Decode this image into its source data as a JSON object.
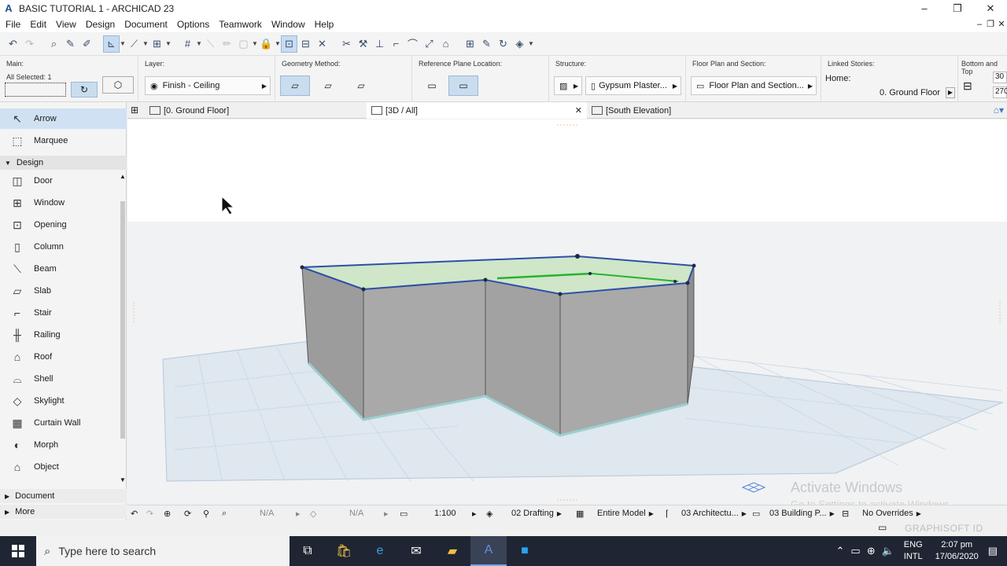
{
  "window": {
    "title": "BASIC TUTORIAL 1 - ARCHICAD 23",
    "controls": [
      "–",
      "❐",
      "✕"
    ]
  },
  "menu": [
    "File",
    "Edit",
    "View",
    "Design",
    "Document",
    "Options",
    "Teamwork",
    "Window",
    "Help"
  ],
  "infobox": {
    "main_label": "Main:",
    "all_selected": "All Selected: 1",
    "layer_label": "Layer:",
    "layer_value": "Finish - Ceiling",
    "geometry_label": "Geometry Method:",
    "refplane_label": "Reference Plane Location:",
    "structure_label": "Structure:",
    "structure_value": "Gypsum Plaster...",
    "floorplan_label": "Floor Plan and Section:",
    "floorplan_value": "Floor Plan and Section...",
    "linked_label": "Linked Stories:",
    "home_label": "Home:",
    "home_value": "0. Ground Floor",
    "bottomtop_label": "Bottom and Top",
    "val_top": "30",
    "val_bottom": "270"
  },
  "tabs": [
    {
      "label": "[0. Ground Floor]"
    },
    {
      "label": "[3D / All]",
      "close": "✕"
    },
    {
      "label": "[South Elevation]"
    }
  ],
  "palette": {
    "tools_top": [
      {
        "label": "Arrow",
        "selected": true
      },
      {
        "label": "Marquee"
      }
    ],
    "design_group": "Design",
    "design_items": [
      "Door",
      "Window",
      "Opening",
      "Column",
      "Beam",
      "Slab",
      "Stair",
      "Railing",
      "Roof",
      "Shell",
      "Skylight",
      "Curtain Wall",
      "Morph",
      "Object"
    ],
    "document_group": "Document",
    "more_group": "More"
  },
  "statusbar": {
    "na1": "N/A",
    "na2": "N/A",
    "scale": "1:100",
    "layer_combo": "02 Drafting",
    "model": "Entire Model",
    "pen_set": "03 Architectu...",
    "mvo": "03 Building P...",
    "overrides": "No Overrides"
  },
  "watermark": {
    "line1": "Activate Windows",
    "line2": "Go to Settings to activate Windows."
  },
  "brand": "GRAPHISOFT ID",
  "taskbar": {
    "search_placeholder": "Type here to search",
    "lang1": "ENG",
    "lang2": "INTL",
    "time": "2:07 pm",
    "date": "17/06/2020"
  }
}
